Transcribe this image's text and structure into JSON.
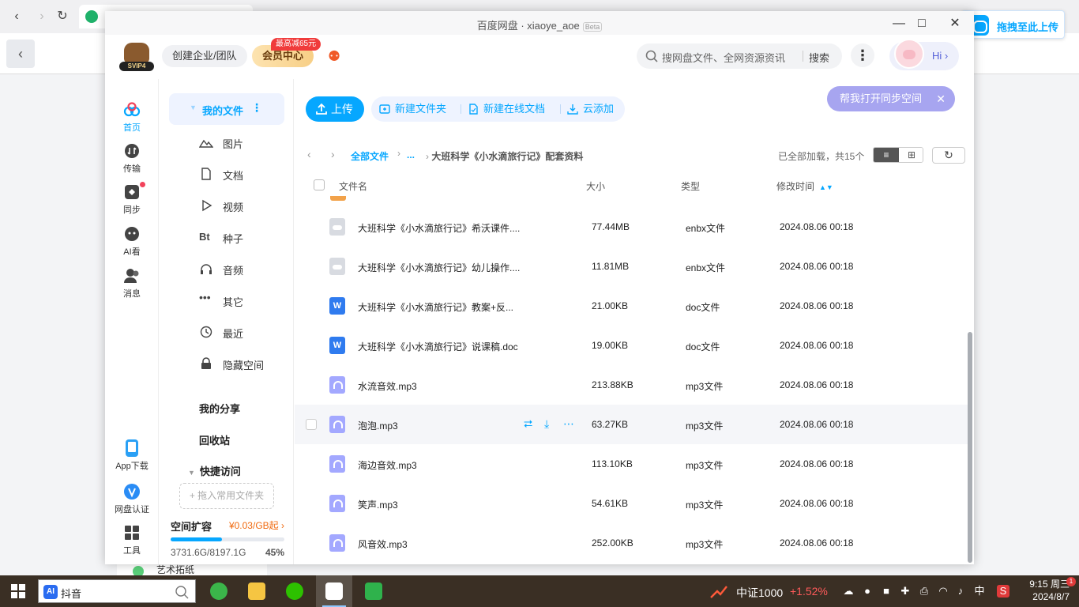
{
  "window": {
    "title": "百度网盘 · xiaoye_aoe",
    "beta": "Beta"
  },
  "header": {
    "svip": "SVIP4",
    "team": "创建企业/团队",
    "vip": "会员中心",
    "promo": "最高减65元",
    "search_placeholder": "搜网盘文件、全网资源资讯",
    "search_btn": "搜索",
    "hi": "Hi"
  },
  "drag_upload": "拖拽至此上传",
  "rail": [
    {
      "label": "首页"
    },
    {
      "label": "传输"
    },
    {
      "label": "同步"
    },
    {
      "label": "AI看"
    },
    {
      "label": "消息"
    },
    {
      "label": "App下载"
    },
    {
      "label": "网盘认证"
    },
    {
      "label": "工具"
    }
  ],
  "nav": {
    "my_files": "我的文件",
    "subs": [
      "图片",
      "文档",
      "视频",
      "种子",
      "音频",
      "其它",
      "最近",
      "隐藏空间"
    ],
    "my_share": "我的分享",
    "recycle": "回收站",
    "quick": "快捷访问",
    "dropzone": "+ 拖入常用文件夹",
    "quota": {
      "title": "空间扩容",
      "price": "¥0.03/GB起",
      "used": "3731.6G/8197.1G",
      "percent": "45%",
      "fraction": 0.45
    }
  },
  "toolbar": {
    "upload": "上传",
    "new_folder": "新建文件夹",
    "new_doc": "新建在线文档",
    "cloud_add": "云添加",
    "sync": "帮我打开同步空间"
  },
  "breadcrumb": {
    "all": "全部文件",
    "ellipsis": "...",
    "current": "大班科学《小水滴旅行记》配套资料"
  },
  "status": "已全部加载，共15个",
  "columns": {
    "name": "文件名",
    "size": "大小",
    "type": "类型",
    "time": "修改时间"
  },
  "files": [
    {
      "icon": "cloud",
      "name": "大班科学《小水滴旅行记》希沃课件....",
      "size": "77.44MB",
      "type": "enbx文件",
      "time": "2024.08.06 00:18"
    },
    {
      "icon": "cloud",
      "name": "大班科学《小水滴旅行记》幼儿操作....",
      "size": "11.81MB",
      "type": "enbx文件",
      "time": "2024.08.06 00:18"
    },
    {
      "icon": "word",
      "name": "大班科学《小水滴旅行记》教案+反...",
      "size": "21.00KB",
      "type": "doc文件",
      "time": "2024.08.06 00:18"
    },
    {
      "icon": "word",
      "name": "大班科学《小水滴旅行记》说课稿.doc",
      "size": "19.00KB",
      "type": "doc文件",
      "time": "2024.08.06 00:18"
    },
    {
      "icon": "audio",
      "name": "水流音效.mp3",
      "size": "213.88KB",
      "type": "mp3文件",
      "time": "2024.08.06 00:18"
    },
    {
      "icon": "audio",
      "name": "泡泡.mp3",
      "size": "63.27KB",
      "type": "mp3文件",
      "time": "2024.08.06 00:18"
    },
    {
      "icon": "audio",
      "name": "海边音效.mp3",
      "size": "113.10KB",
      "type": "mp3文件",
      "time": "2024.08.06 00:18"
    },
    {
      "icon": "audio",
      "name": "笑声.mp3",
      "size": "54.61KB",
      "type": "mp3文件",
      "time": "2024.08.06 00:18"
    },
    {
      "icon": "audio",
      "name": "风音效.mp3",
      "size": "252.00KB",
      "type": "mp3文件",
      "time": "2024.08.06 00:18"
    }
  ],
  "browser_peek": "艺术拓纸",
  "taskbar": {
    "search_text": "抖音",
    "ai_badge": "AI",
    "stock_name": "中证1000",
    "stock_change": "+1.52%",
    "ime": "中",
    "time": "9:15 周三",
    "date": "2024/8/7",
    "notif_count": "1"
  }
}
